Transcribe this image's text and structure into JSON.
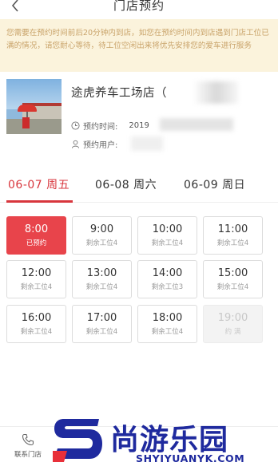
{
  "header": {
    "title": "门店预约",
    "back_icon": "back-arrow-icon"
  },
  "notice": "您需要在预约时间前后20分钟内到店，如您在预约时间内到店遇到门店工位已满的情况，请您耐心等待，待工位空闲出来将优先安排您的爱车进行服务",
  "store": {
    "name": "途虎养车工场店（",
    "time_label": "预约时间:",
    "time_value": "2019",
    "user_label": "预约用户:",
    "user_value": "",
    "clock_icon": "clock-icon",
    "user_icon": "user-icon"
  },
  "date_tabs": [
    {
      "label": "06-07 周五",
      "active": true
    },
    {
      "label": "06-08 周六",
      "active": false
    },
    {
      "label": "06-09 周日",
      "active": false
    }
  ],
  "slots": [
    {
      "time": "8:00",
      "status": "已预约",
      "state": "booked"
    },
    {
      "time": "9:00",
      "status": "剩余工位4",
      "state": "available"
    },
    {
      "time": "10:00",
      "status": "剩余工位4",
      "state": "available"
    },
    {
      "time": "11:00",
      "status": "剩余工位4",
      "state": "available"
    },
    {
      "time": "12:00",
      "status": "剩余工位4",
      "state": "available"
    },
    {
      "time": "13:00",
      "status": "剩余工位4",
      "state": "available"
    },
    {
      "time": "14:00",
      "status": "剩余工位3",
      "state": "available"
    },
    {
      "time": "15:00",
      "status": "剩余工位4",
      "state": "available"
    },
    {
      "time": "16:00",
      "status": "剩余工位4",
      "state": "available"
    },
    {
      "time": "17:00",
      "status": "剩余工位4",
      "state": "available"
    },
    {
      "time": "18:00",
      "status": "剩余工位4",
      "state": "available"
    },
    {
      "time": "19:00",
      "status": "约 满",
      "state": "full"
    }
  ],
  "bottom": {
    "contact_label": "联系门店",
    "contact_icon": "phone-icon"
  },
  "watermark": {
    "text": "尚游乐园",
    "url": "SHYIYUANYK.COM"
  },
  "colors": {
    "accent": "#d8363d",
    "notice_bg": "#fbf3dc",
    "notice_text": "#c9a36a",
    "watermark": "#1f2a9e"
  }
}
